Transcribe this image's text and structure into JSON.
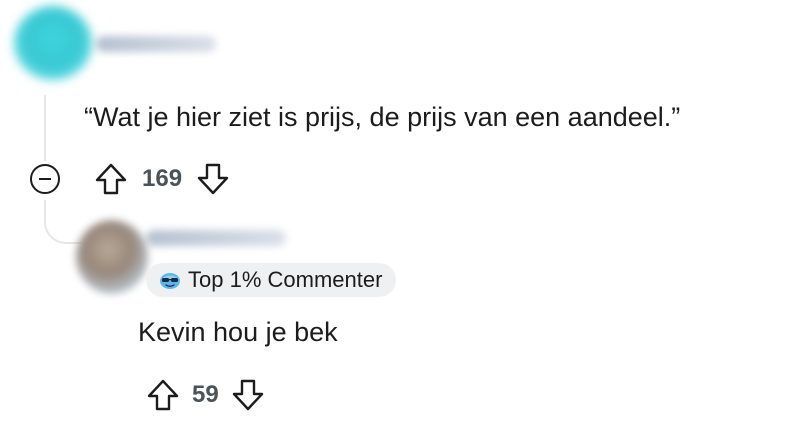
{
  "comments": [
    {
      "text": "“Wat je hier ziet is prijs, de prijs van een aandeel.”",
      "votes": "169"
    },
    {
      "badge": "Top 1% Commenter",
      "text": "Kevin hou je bek",
      "votes": "59"
    }
  ],
  "icons": {
    "collapse": "collapse-icon",
    "upvote": "upvote-arrow-icon",
    "downvote": "downvote-arrow-icon",
    "badge": "sunglasses-emoji-icon"
  },
  "colors": {
    "avatar_1": "#37c8d3",
    "vote_count": "#4a5359",
    "badge_background": "#eef0f2",
    "thread_line": "#e4e6e8"
  }
}
